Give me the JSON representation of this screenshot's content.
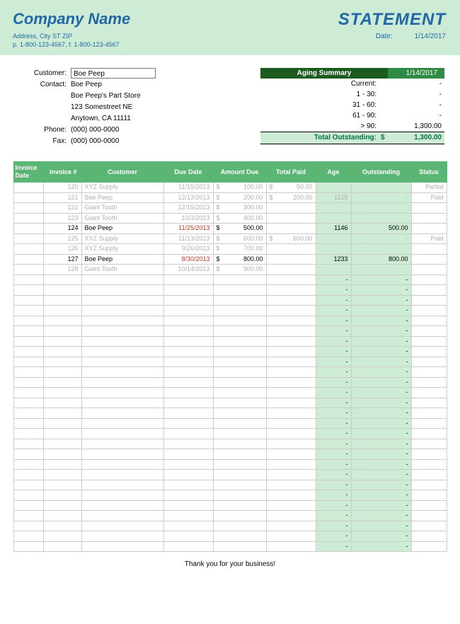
{
  "header": {
    "company": "Company Name",
    "address": "Address, City ST ZIP",
    "phone": "p. 1-800-123-4567, f. 1-800-123-4567",
    "title": "STATEMENT",
    "date_label": "Date:",
    "date": "1/14/2017"
  },
  "customer": {
    "name_label": "Customer:",
    "name": "Boe Peep",
    "contact_label": "Contact:",
    "contact": "Boe Peep",
    "store": "Boe Peep's Part Store",
    "street": "123 Somestreet NE",
    "citystate": "Anytown, CA 11111",
    "phone_label": "Phone:",
    "phone": "(000) 000-0000",
    "fax_label": "Fax:",
    "fax": "(000) 000-0000"
  },
  "aging": {
    "title": "Aging Summary",
    "date": "1/14/2017",
    "rows": [
      {
        "k": "Current:",
        "v": "-"
      },
      {
        "k": "1 - 30:",
        "v": "-"
      },
      {
        "k": "31 - 60:",
        "v": "-"
      },
      {
        "k": "61 - 90:",
        "v": "-"
      },
      {
        "k": "> 90:",
        "v": "1,300.00"
      }
    ],
    "total_label": "Total Outstanding:",
    "total_cur": "$",
    "total": "1,300.00"
  },
  "columns": [
    "Invoice Date",
    "Invoice #",
    "Customer",
    "Due Date",
    "Amount Due",
    "Total Paid",
    "Age",
    "Outstanding",
    "Status"
  ],
  "rows": [
    {
      "muted": true,
      "num": "120",
      "cust": "XYZ Supply",
      "due": "11/15/2013",
      "amt_c": "$",
      "amt": "100.00",
      "paid_c": "$",
      "paid": "50.00",
      "age": "",
      "out": "",
      "status": "Partial"
    },
    {
      "muted": true,
      "num": "121",
      "cust": "Boe Peep",
      "due": "12/13/2013",
      "amt_c": "$",
      "amt": "200.00",
      "paid_c": "$",
      "paid": "200.00",
      "age": "1128",
      "out": "-",
      "status": "Paid"
    },
    {
      "muted": true,
      "num": "122",
      "cust": "Giant Tooth",
      "due": "12/15/2013",
      "amt_c": "$",
      "amt": "300.00",
      "paid_c": "",
      "paid": "",
      "age": "",
      "out": "",
      "status": ""
    },
    {
      "muted": true,
      "num": "123",
      "cust": "Giant Tooth",
      "due": "10/3/2013",
      "amt_c": "$",
      "amt": "400.00",
      "paid_c": "",
      "paid": "",
      "age": "",
      "out": "",
      "status": ""
    },
    {
      "muted": false,
      "num": "124",
      "cust": "Boe Peep",
      "due": "11/25/2013",
      "due_red": true,
      "amt_c": "$",
      "amt": "500.00",
      "paid_c": "",
      "paid": "",
      "age": "1146",
      "out": "500.00",
      "status": ""
    },
    {
      "muted": true,
      "num": "125",
      "cust": "XYZ Supply",
      "due": "11/13/2013",
      "amt_c": "$",
      "amt": "600.00",
      "paid_c": "$",
      "paid": "600.00",
      "age": "",
      "out": "-",
      "status": "Paid"
    },
    {
      "muted": true,
      "num": "126",
      "cust": "XYZ Supply",
      "due": "9/26/2013",
      "amt_c": "$",
      "amt": "700.00",
      "paid_c": "",
      "paid": "",
      "age": "",
      "out": "",
      "status": ""
    },
    {
      "muted": false,
      "num": "127",
      "cust": "Boe Peep",
      "due": "8/30/2013",
      "due_red": true,
      "amt_c": "$",
      "amt": "800.00",
      "paid_c": "",
      "paid": "",
      "age": "1233",
      "out": "800.00",
      "status": ""
    },
    {
      "muted": true,
      "num": "128",
      "cust": "Giant Tooth",
      "due": "10/14/2013",
      "amt_c": "$",
      "amt": "900.00",
      "paid_c": "",
      "paid": "",
      "age": "",
      "out": "",
      "status": ""
    }
  ],
  "empty_rows": 27,
  "dash": "-",
  "footer": "Thank you for your business!"
}
